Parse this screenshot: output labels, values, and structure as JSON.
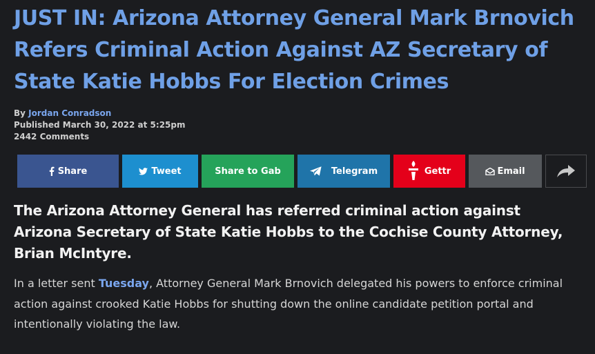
{
  "article": {
    "headline": "JUST IN: Arizona Attorney General Mark Brnovich Refers Criminal Action Against AZ Secretary of State Katie Hobbs For Election Crimes",
    "byline_prefix": "By",
    "author": "Jordan Conradson",
    "published": "Published March 30, 2022 at 5:25pm",
    "comments": "2442 Comments",
    "lead": "The Arizona Attorney General has referred criminal action against Arizona Secretary of State Katie Hobbs to the Cochise County Attorney, Brian McIntyre.",
    "paragraph_before_link": "In a letter sent ",
    "paragraph_link": "Tuesday",
    "paragraph_after_link": ", Attorney General Mark Brnovich delegated his powers to enforce criminal action against crooked Katie Hobbs for shutting down the online candidate petition portal and intentionally violating the law."
  },
  "share": {
    "facebook": {
      "label": "Share",
      "icon": "facebook-icon",
      "color": "#3a5590"
    },
    "twitter": {
      "label": "Tweet",
      "icon": "twitter-bird-icon",
      "color": "#1d8fcf"
    },
    "gab": {
      "label": "Share to Gab",
      "color": "#25a35a"
    },
    "telegram": {
      "label": "Telegram",
      "icon": "paper-plane-icon",
      "color": "#1f74a9"
    },
    "gettr": {
      "label": "Gettr",
      "icon": "gettr-torch-icon",
      "color": "#e4001a"
    },
    "email": {
      "label": "Email",
      "icon": "envelope-icon",
      "color": "#55585c"
    },
    "more": {
      "icon": "share-arrow-icon"
    }
  },
  "colors": {
    "background": "#1b1c1f",
    "headline": "#6fa0e6",
    "link": "#7aa6ee"
  }
}
